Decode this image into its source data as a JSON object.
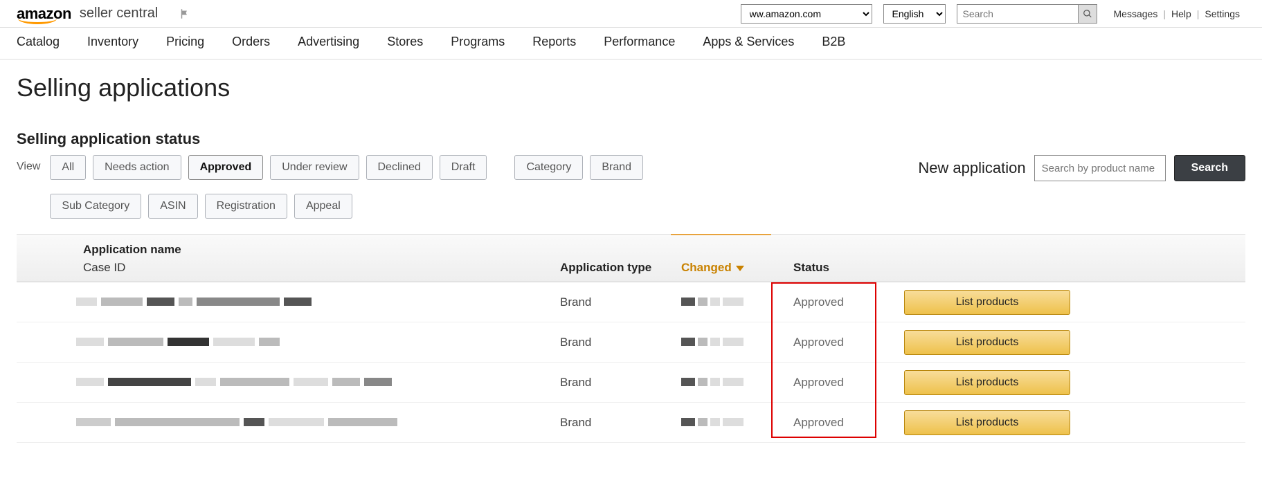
{
  "header": {
    "logo_brand": "amazon",
    "logo_product": "seller central",
    "domain_value": "ww.amazon.com",
    "language_value": "English",
    "search_placeholder": "Search",
    "links": {
      "messages": "Messages",
      "help": "Help",
      "settings": "Settings"
    }
  },
  "nav": [
    "Catalog",
    "Inventory",
    "Pricing",
    "Orders",
    "Advertising",
    "Stores",
    "Programs",
    "Reports",
    "Performance",
    "Apps & Services",
    "B2B"
  ],
  "page": {
    "title": "Selling applications",
    "subtitle": "Selling application status",
    "view_label": "View",
    "filters_row1": [
      "All",
      "Needs action",
      "Approved",
      "Under review",
      "Declined",
      "Draft"
    ],
    "filters_row1_active": "Approved",
    "filters_row1b": [
      "Category",
      "Brand"
    ],
    "filters_row2": [
      "Sub Category",
      "ASIN",
      "Registration",
      "Appeal"
    ],
    "new_app_label": "New application",
    "new_app_placeholder": "Search by product name or ASIN",
    "new_app_button": "Search"
  },
  "table": {
    "headers": {
      "name": "Application name",
      "name_sub": "Case ID",
      "type": "Application type",
      "changed": "Changed",
      "status": "Status"
    },
    "rows": [
      {
        "type": "Brand",
        "status": "Approved",
        "action": "List products"
      },
      {
        "type": "Brand",
        "status": "Approved",
        "action": "List products"
      },
      {
        "type": "Brand",
        "status": "Approved",
        "action": "List products"
      },
      {
        "type": "Brand",
        "status": "Approved",
        "action": "List products"
      }
    ]
  }
}
